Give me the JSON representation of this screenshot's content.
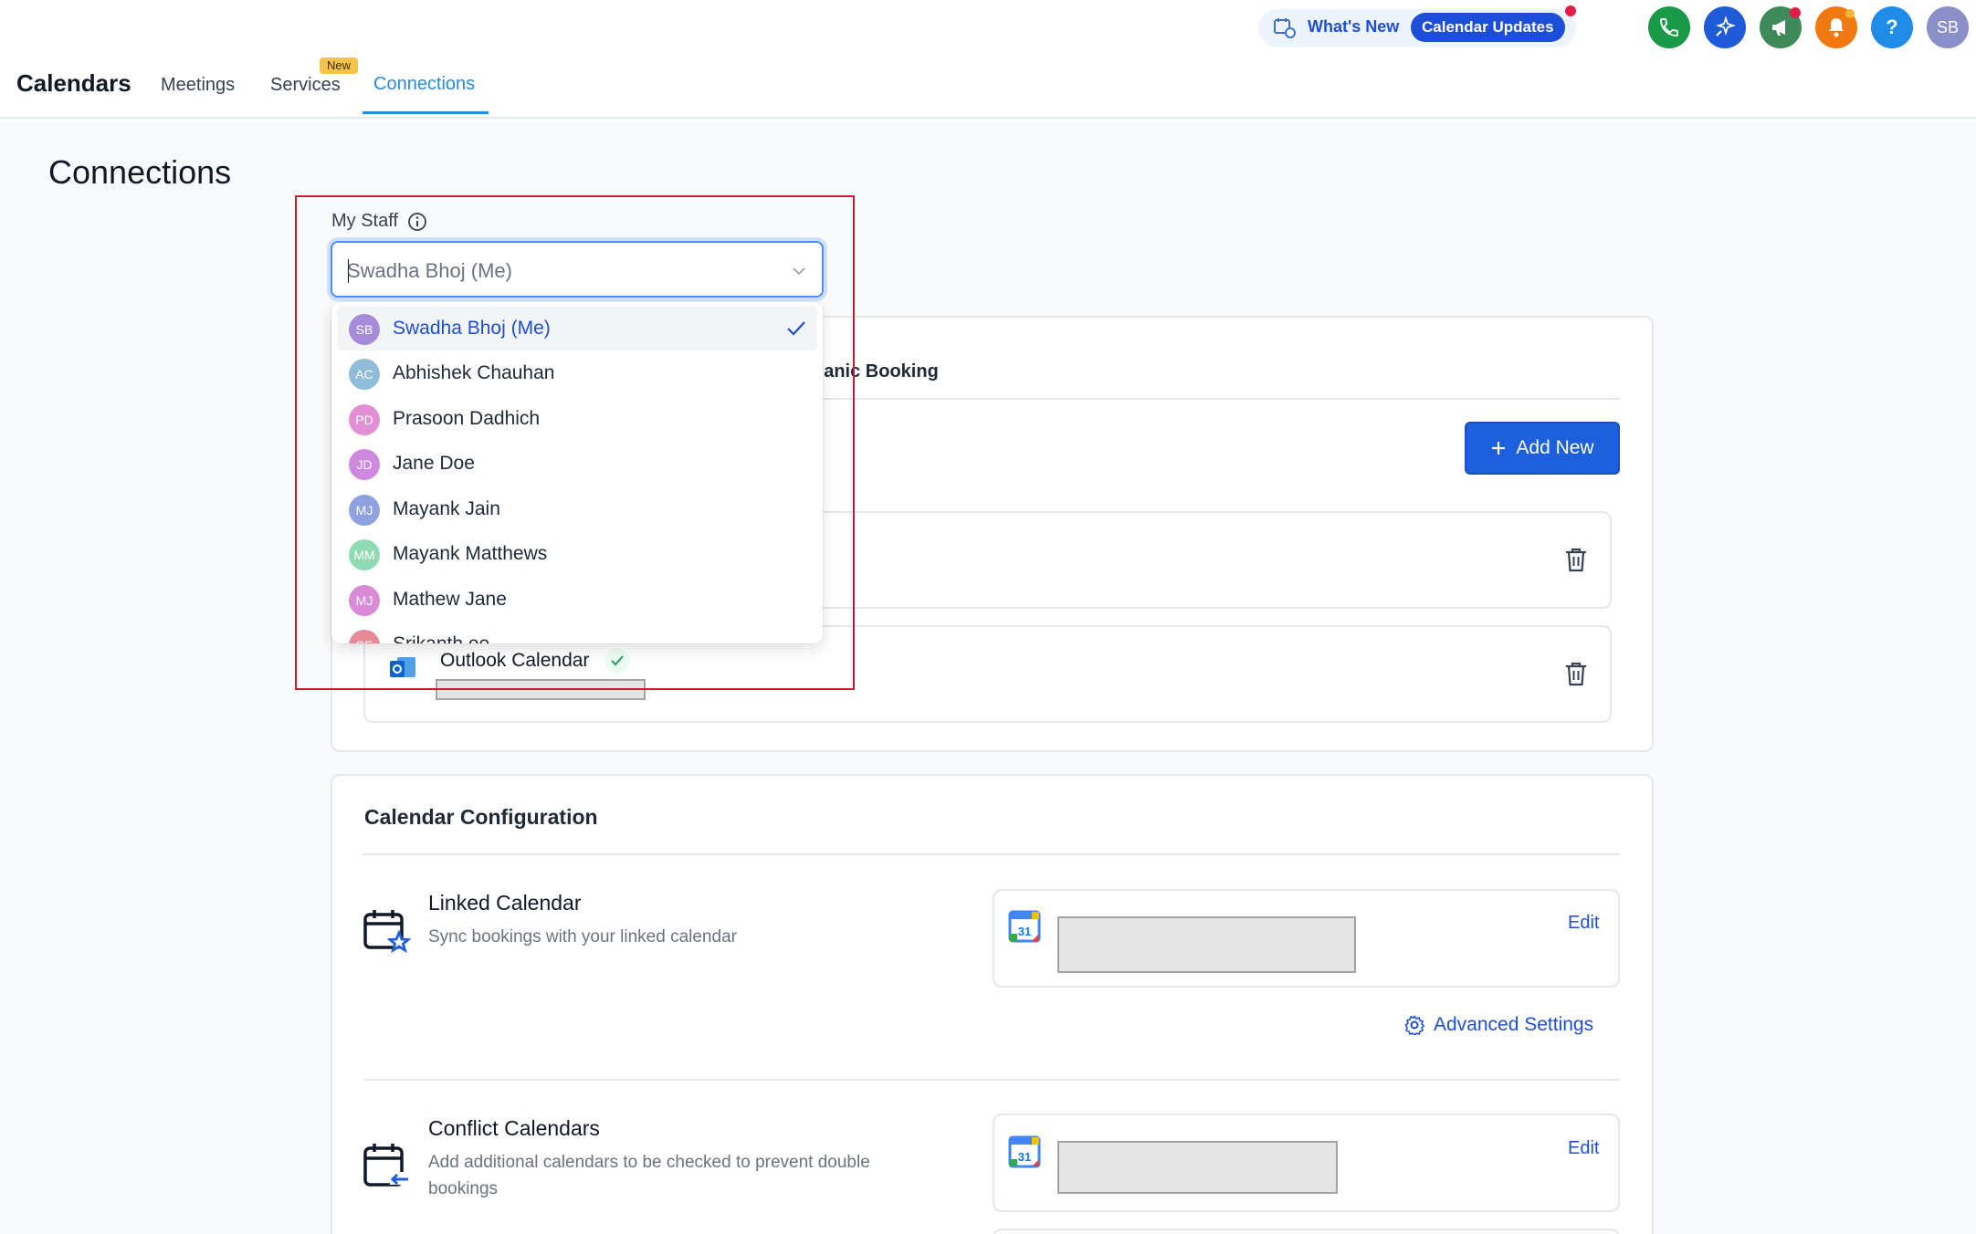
{
  "header": {
    "brand": "Calendars",
    "tabs": [
      {
        "label": "Meetings"
      },
      {
        "label": "Services",
        "badge": "New"
      },
      {
        "label": "Connections"
      }
    ],
    "whats_new": "What's New",
    "calendar_updates": "Calendar Updates",
    "help_label": "?",
    "user_initials": "SB",
    "icons": [
      "phone-icon",
      "sparkle-icon",
      "megaphone-icon",
      "bell-icon",
      "help-icon"
    ],
    "colors": {
      "phone": "#1a9a48",
      "sparkle": "#1f5bd8",
      "megaphone": "#3f8a5a",
      "bell": "#f07a11",
      "help": "#1f8ce8",
      "avatar": "#8a8fc8"
    }
  },
  "page": {
    "title": "Connections"
  },
  "staff": {
    "label": "My Staff",
    "selected": "Swadha Bhoj (Me)",
    "options": [
      {
        "initials": "SB",
        "name": "Swadha Bhoj (Me)",
        "color": "#a78bdb",
        "selected": true
      },
      {
        "initials": "AC",
        "name": "Abhishek Chauhan",
        "color": "#8fbcd8"
      },
      {
        "initials": "PD",
        "name": "Prasoon Dadhich",
        "color": "#e38fd6"
      },
      {
        "initials": "JD",
        "name": "Jane Doe",
        "color": "#cf8ae0"
      },
      {
        "initials": "MJ",
        "name": "Mayank Jain",
        "color": "#8ea2e0"
      },
      {
        "initials": "MM",
        "name": "Mayank Matthews",
        "color": "#8fdcb4"
      },
      {
        "initials": "MJ",
        "name": "Mathew Jane",
        "color": "#d98bd8"
      },
      {
        "initials": "SE",
        "name": "Srikanth ee",
        "color": "#e58a96"
      }
    ]
  },
  "connections": {
    "tab_partial": "ganic Booking",
    "add_new": "Add New",
    "outlook_label": "Outlook Calendar"
  },
  "configuration": {
    "title": "Calendar Configuration",
    "linked": {
      "title": "Linked Calendar",
      "desc": "Sync bookings with your linked calendar",
      "edit": "Edit",
      "advanced": "Advanced Settings"
    },
    "conflict": {
      "title": "Conflict Calendars",
      "desc": "Add additional calendars to be checked to prevent double bookings",
      "edit": "Edit"
    }
  }
}
